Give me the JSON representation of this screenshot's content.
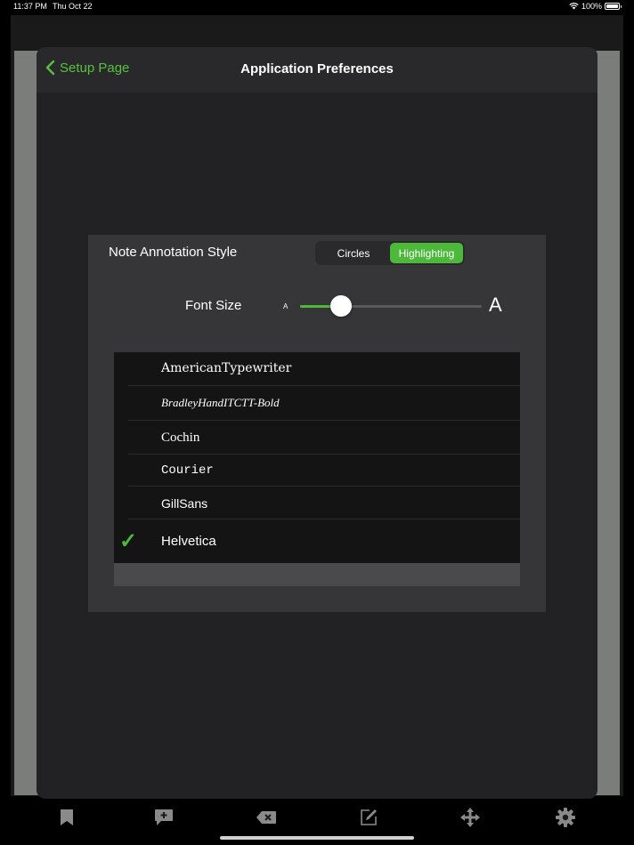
{
  "status_bar": {
    "time": "11:37 PM",
    "date": "Thu Oct 22",
    "battery": "100%"
  },
  "header": {
    "back_label": "Setup Page",
    "title": "Application Preferences"
  },
  "annotation": {
    "label": "Note Annotation Style",
    "options": [
      "Circles",
      "Highlighting"
    ],
    "selected": "Highlighting"
  },
  "font_size": {
    "label": "Font Size",
    "small_glyph": "A",
    "large_glyph": "A",
    "value": 0.19
  },
  "fonts": [
    {
      "name": "AmericanTypewriter",
      "selected": false
    },
    {
      "name": "BradleyHandITCTT-Bold",
      "selected": false
    },
    {
      "name": "Cochin",
      "selected": false
    },
    {
      "name": "Courier",
      "selected": false
    },
    {
      "name": "GillSans",
      "selected": false
    },
    {
      "name": "Helvetica",
      "selected": true
    }
  ],
  "check_glyph": "✓",
  "toolbar": [
    "bookmark-icon",
    "add-comment-icon",
    "delete-icon",
    "edit-icon",
    "move-icon",
    "gear-icon"
  ],
  "colors": {
    "accent": "#4cb93b",
    "text_accent": "#57c13f",
    "panel": "#363638",
    "modal": "#222224"
  }
}
